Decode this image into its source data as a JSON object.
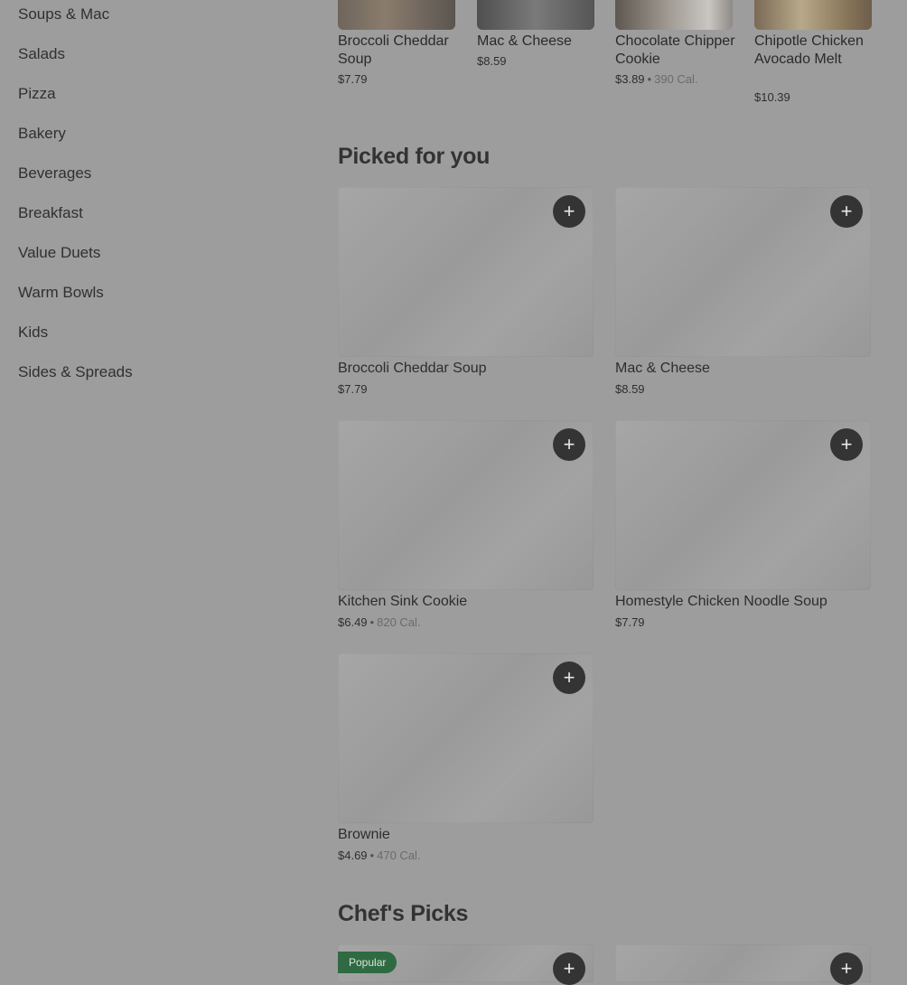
{
  "sidebar": {
    "items": [
      {
        "label": "Soups & Mac"
      },
      {
        "label": "Salads"
      },
      {
        "label": "Pizza"
      },
      {
        "label": "Bakery"
      },
      {
        "label": "Beverages"
      },
      {
        "label": "Breakfast"
      },
      {
        "label": "Value Duets"
      },
      {
        "label": "Warm Bowls"
      },
      {
        "label": "Kids"
      },
      {
        "label": "Sides & Spreads"
      }
    ]
  },
  "strip": {
    "items": [
      {
        "name": "Broccoli Cheddar Soup",
        "price": "$7.79",
        "cal": ""
      },
      {
        "name": "Mac & Cheese",
        "price": "$8.59",
        "cal": ""
      },
      {
        "name": "Chocolate Chipper Cookie",
        "price": "$3.89",
        "cal": "390 Cal."
      },
      {
        "name": "Chipotle Chicken Avocado Melt",
        "price": "$10.39",
        "cal": ""
      }
    ]
  },
  "picked": {
    "title": "Picked for you",
    "items": [
      {
        "name": "Broccoli Cheddar Soup",
        "price": "$7.79",
        "cal": ""
      },
      {
        "name": "Mac & Cheese",
        "price": "$8.59",
        "cal": ""
      },
      {
        "name": "Kitchen Sink Cookie",
        "price": "$6.49",
        "cal": "820 Cal."
      },
      {
        "name": "Homestyle Chicken Noodle Soup",
        "price": "$7.79",
        "cal": ""
      },
      {
        "name": "Brownie",
        "price": "$4.69",
        "cal": "470 Cal."
      }
    ]
  },
  "chefs": {
    "title": "Chef's Picks",
    "badge": "Popular"
  },
  "icons": {
    "add": "plus-icon"
  },
  "colors": {
    "accent_badge": "#2f6a43",
    "button": "#343434",
    "background": "#9d9d9d"
  },
  "separator": "•"
}
